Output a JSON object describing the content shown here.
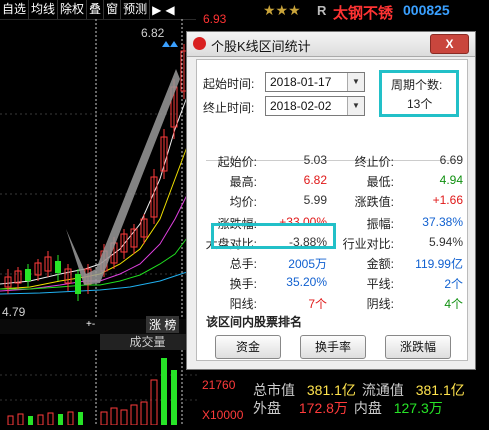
{
  "toolbar": {
    "items": [
      "自选",
      "均线",
      "除权",
      "叠",
      "窗",
      "预测"
    ],
    "arrows": [
      "▶",
      "◀"
    ]
  },
  "header": {
    "price_top": "6.93",
    "rating_stars": "★★★",
    "badge": "R",
    "stock_name": "太钢不锈",
    "stock_code": "000825"
  },
  "chart": {
    "peak_label": "6.82",
    "low_label": "4.79",
    "zoom_symbols": "+‑",
    "zone_label": "涨 榜",
    "volume_title": "成交量",
    "volume_tick_1": "21760",
    "volume_tick_2": "X10000"
  },
  "dialog": {
    "title": "个股K线区间统计",
    "close_label": "X",
    "start_time_label": "起始时间:",
    "start_time_value": "2018-01-17",
    "end_time_label": "终止时间:",
    "end_time_value": "2018-02-02",
    "period_count_label": "周期个数:",
    "period_count_value": "13个",
    "stats": [
      {
        "label": "起始价:",
        "value": "5.03",
        "color": "#333333"
      },
      {
        "label": "终止价:",
        "value": "6.69",
        "color": "#333333"
      },
      {
        "label": "最高:",
        "value": "6.82",
        "color": "#e01818"
      },
      {
        "label": "最低:",
        "value": "4.94",
        "color": "#109010"
      },
      {
        "label": "均价:",
        "value": "5.99",
        "color": "#333333"
      },
      {
        "label": "涨跌值:",
        "value": "+1.66",
        "color": "#e01818"
      },
      {
        "label": "涨跌幅:",
        "value": "+33.00%",
        "color": "#e01818"
      },
      {
        "label": "振幅:",
        "value": "37.38%",
        "color": "#1060d0"
      },
      {
        "label": "大盘对比:",
        "value": "-3.88%",
        "color": "#333333"
      },
      {
        "label": "行业对比:",
        "value": "5.94%",
        "color": "#333333"
      },
      {
        "label": "总手:",
        "value": "2005万",
        "color": "#1060d0"
      },
      {
        "label": "金额:",
        "value": "119.99亿",
        "color": "#1060d0"
      },
      {
        "label": "换手:",
        "value": "35.20%",
        "color": "#1060d0"
      },
      {
        "label": "平线:",
        "value": "2个",
        "color": "#1060d0"
      },
      {
        "label": "阳线:",
        "value": "7个",
        "color": "#e01818"
      },
      {
        "label": "阴线:",
        "value": "4个",
        "color": "#109010"
      }
    ],
    "ranking_title": "该区间内股票排名",
    "buttons": [
      "资金",
      "换手率",
      "涨跌幅"
    ]
  },
  "info": {
    "rows": [
      {
        "label1": "总市值",
        "value1": "381.1亿",
        "label2": "流通值",
        "value2": "381.1亿"
      },
      {
        "label1": "外盘",
        "value1": "172.8万",
        "label2": "内盘",
        "value2": "127.3万"
      }
    ]
  },
  "colors": {
    "background": "#000000",
    "up": "#ff3b3b",
    "down": "#27e427",
    "highlight_box": "#22c0c8",
    "dialog_bg": "#eeeeee"
  }
}
